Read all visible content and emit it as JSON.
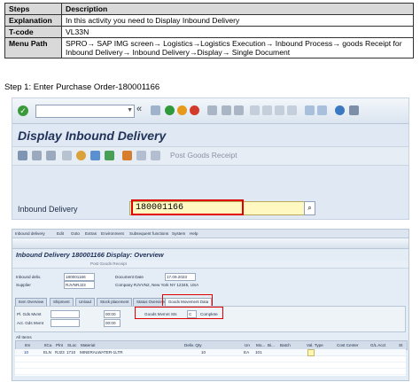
{
  "instructions": {
    "header": {
      "steps": "Steps",
      "description": "Description"
    },
    "rows": [
      {
        "key": "Explanation",
        "value": "In this activity you need to Display Inbound Delivery"
      },
      {
        "key": "T-code",
        "value": "VL33N"
      },
      {
        "key": "Menu Path",
        "value": "SPRO→ SAP IMG screen→ Logistics→Logistics Execution→ Inbound Process→ goods Receipt for Inbound Delivery→ Inbound Delivery→Display→ Single Document"
      }
    ]
  },
  "step1": "Step 1: Enter Purchase Order-180001166",
  "screen1": {
    "title": "Display Inbound Delivery",
    "post_goods_receipt": "Post Goods Receipt",
    "inbound_delivery_label": "Inbound Delivery",
    "inbound_delivery_value": "180001166",
    "back_symbol": "«"
  },
  "screen2": {
    "menu": [
      "Inbound delivery",
      "Edit",
      "Goto",
      "Extras",
      "Environment",
      "Subsequent functions",
      "System",
      "Help"
    ],
    "title": "Inbound Delivery 180001166 Display: Overview",
    "post_goods_receipt": "Post Goods Receipt",
    "inbound_deliv_label": "Inbound deliv.",
    "inbound_deliv_value": "180001166",
    "supplier_label": "Supplier",
    "supplier_value": "RJVNRJ23",
    "document_date_label": "Document Date",
    "document_date_value": "17.09.2023",
    "company": "Company RJVVN2, New York NY 12345, USA",
    "tabs": [
      "Item Overview",
      "Shipment",
      "Unload",
      "Stock placement",
      "Status Overview",
      "Goods Movement Data"
    ],
    "pl_gds_mvmt_label": "Pl. Gds Mvmt",
    "pl_gds_mvmt_value": "00:00",
    "act_gds_mvmt_label": "Act. Gds Mvmt",
    "act_gds_mvmt_value": "00:00",
    "goods_mvmnt_sts_label": "Goods Mvmnt Sts",
    "goods_mvmnt_sts_value": "C",
    "goods_mvmnt_sts_text": "Complete",
    "all_items": "All Items",
    "columns": [
      "Itm",
      "ItCa",
      "Plnt",
      "SLoc",
      "Material",
      "Deliv. Qty",
      "Un",
      "Mo...",
      "Bi...",
      "Batch",
      "Val. Type",
      "Cost Center",
      "G/L Acct",
      "St"
    ],
    "row": {
      "itm": "10",
      "itca": "ELN",
      "plnt": "RJ23",
      "sloc": "1710",
      "material": "MINERALWATER-1LTR",
      "qty": "10",
      "un": "EA",
      "mo": "101"
    }
  }
}
